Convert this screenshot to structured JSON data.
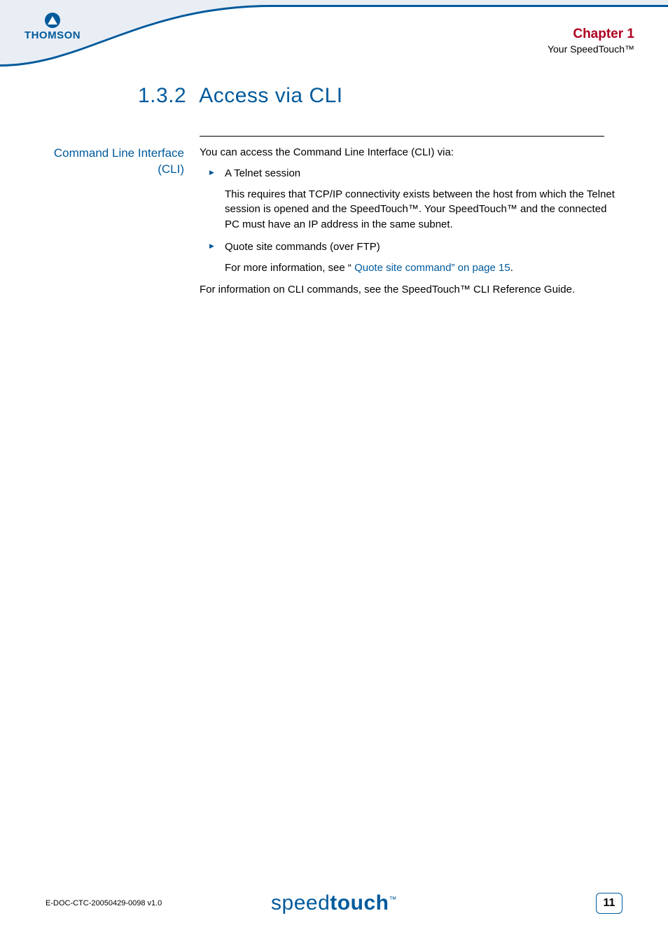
{
  "brand_logo_text": "THOMSON",
  "header": {
    "chapter": "Chapter 1",
    "chapter_subtitle": "Your SpeedTouch™"
  },
  "section": {
    "number": "1.3.2",
    "title": "Access via CLI"
  },
  "side_label": "Command Line Interface (CLI)",
  "body": {
    "intro": "You can access the Command Line Interface (CLI) via:",
    "bullets": [
      {
        "title": "A Telnet session",
        "detail": "This requires that TCP/IP connectivity exists between the host from which the Telnet session is opened and the SpeedTouch™. Your SpeedTouch™ and the connected PC must have an IP address in the same subnet."
      },
      {
        "title": "Quote site commands (over FTP)",
        "detail_prefix": "For more information, see “",
        "xref": " Quote site command” on page 15",
        "detail_suffix": "."
      }
    ],
    "outro": "For information on CLI commands, see the SpeedTouch™ CLI Reference Guide."
  },
  "footer": {
    "doc_id": "E-DOC-CTC-20050429-0098 v1.0",
    "logo_light": "speed",
    "logo_bold": "touch",
    "logo_tm": "™",
    "page_number": "11"
  }
}
